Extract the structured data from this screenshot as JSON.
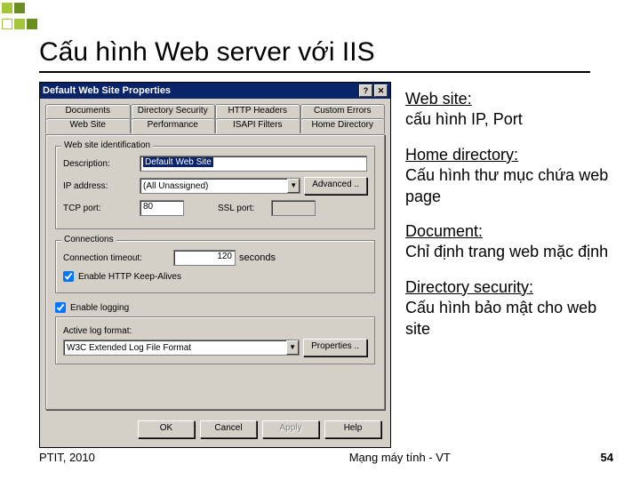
{
  "deco_colors": [
    "#a4c639",
    "#6b8e23",
    "#d4d0c8",
    "#a4c639",
    "#6b8e23"
  ],
  "slide_title": "Cấu hình Web server với IIS",
  "dialog": {
    "title": "Default Web Site Properties",
    "tabs_row2": [
      "Documents",
      "Directory Security",
      "HTTP Headers",
      "Custom Errors"
    ],
    "tabs_row1": [
      "Web Site",
      "Performance",
      "ISAPI Filters",
      "Home Directory"
    ],
    "active_tab": "Web Site",
    "group_ident": "Web site identification",
    "desc_label": "Description:",
    "desc_value": "Default Web Site",
    "ip_label": "IP address:",
    "ip_value": "(All Unassigned)",
    "advanced": "Advanced ..",
    "tcp_label": "TCP port:",
    "tcp_value": "80",
    "ssl_label": "SSL port:",
    "group_conn": "Connections",
    "timeout_label": "Connection timeout:",
    "timeout_value": "120",
    "seconds": "seconds",
    "keepalive": "Enable HTTP Keep-Alives",
    "logging": "Enable logging",
    "active_log_label": "Active log format:",
    "log_format": "W3C Extended Log File Format",
    "properties": "Properties ..",
    "ok": "OK",
    "cancel": "Cancel",
    "apply": "Apply",
    "help": "Help"
  },
  "notes": {
    "n1h": "Web site:",
    "n1b": "cấu hình IP, Port",
    "n2h": "Home directory:",
    "n2b": "Cấu hình thư mục chứa web page",
    "n3h": "Document:",
    "n3b": "Chỉ định trang web mặc định",
    "n4h": "Directory security:",
    "n4b": "Cấu hình bảo mật cho web site"
  },
  "footer": {
    "left": "PTIT, 2010",
    "center": "Mạng máy tính - VT",
    "right": "54"
  }
}
